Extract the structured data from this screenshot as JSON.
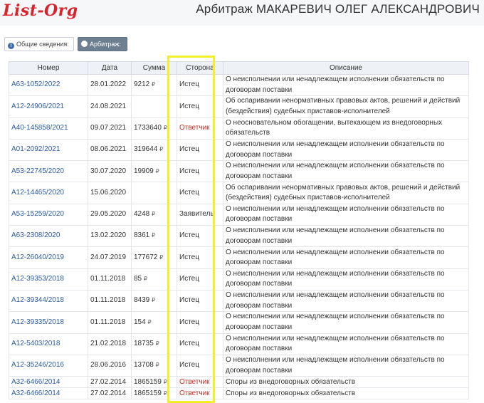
{
  "header": {
    "logo": "List-Org",
    "title": "Арбитраж МАКАРЕВИЧ ОЛЕГ АЛЕКСАНДРОВИЧ"
  },
  "tabs": [
    {
      "label": "Общие сведения:",
      "icon": "info-icon",
      "active": false
    },
    {
      "label": "Арбитраж:",
      "icon": "circle-icon",
      "active": true
    }
  ],
  "table": {
    "columns": [
      "Номер",
      "Дата",
      "Сумма",
      "Сторона",
      "Описание"
    ],
    "currency": "₽",
    "rows": [
      {
        "number": "А63-1052/2022",
        "date": "28.01.2022",
        "sum": "9212",
        "side": "Истец",
        "role": "plaintiff",
        "desc": "О неисполнении или ненадлежащем исполнении обязательств по договорам поставки"
      },
      {
        "number": "А12-24906/2021",
        "date": "24.08.2021",
        "sum": "",
        "side": "Истец",
        "role": "plaintiff",
        "desc": "Об оспаривании ненормативных правовых актов, решений и действий (бездействия) судебных приставов-исполнителей"
      },
      {
        "number": "А40-145858/2021",
        "date": "09.07.2021",
        "sum": "1733640",
        "side": "Ответчик",
        "role": "defendant",
        "desc": "О неосновательном обогащении, вытекающем из внедоговорных обязательств"
      },
      {
        "number": "А01-2092/2021",
        "date": "08.06.2021",
        "sum": "319644",
        "side": "Истец",
        "role": "plaintiff",
        "desc": "О неисполнении или ненадлежащем исполнении обязательств по договорам поставки"
      },
      {
        "number": "А53-22745/2020",
        "date": "30.07.2020",
        "sum": "19909",
        "side": "Истец",
        "role": "plaintiff",
        "desc": "О неисполнении или ненадлежащем исполнении обязательств по договорам поставки"
      },
      {
        "number": "А12-14465/2020",
        "date": "15.06.2020",
        "sum": "",
        "side": "Истец",
        "role": "plaintiff",
        "desc": "Об оспаривании ненормативных правовых актов, решений и действий (бездействия) судебных приставов-исполнителей"
      },
      {
        "number": "А53-15259/2020",
        "date": "29.05.2020",
        "sum": "4248",
        "side": "Заявитель",
        "role": "plaintiff",
        "desc": "О неисполнении или ненадлежащем исполнении обязательств по договорам поставки"
      },
      {
        "number": "А63-2308/2020",
        "date": "13.02.2020",
        "sum": "8361",
        "side": "Истец",
        "role": "plaintiff",
        "desc": "О неисполнении или ненадлежащем исполнении обязательств по договорам поставки"
      },
      {
        "number": "А12-26040/2019",
        "date": "24.07.2019",
        "sum": "177672",
        "side": "Истец",
        "role": "plaintiff",
        "desc": "О неисполнении или ненадлежащем исполнении обязательств по договорам поставки"
      },
      {
        "number": "А12-39353/2018",
        "date": "01.11.2018",
        "sum": "85",
        "side": "Истец",
        "role": "plaintiff",
        "desc": "О неисполнении или ненадлежащем исполнении обязательств по договорам поставки"
      },
      {
        "number": "А12-39344/2018",
        "date": "01.11.2018",
        "sum": "8439",
        "side": "Истец",
        "role": "plaintiff",
        "desc": "О неисполнении или ненадлежащем исполнении обязательств по договорам поставки"
      },
      {
        "number": "А12-39335/2018",
        "date": "01.11.2018",
        "sum": "154",
        "side": "Истец",
        "role": "plaintiff",
        "desc": "О неисполнении или ненадлежащем исполнении обязательств по договорам поставки"
      },
      {
        "number": "А12-5403/2018",
        "date": "21.02.2018",
        "sum": "18735",
        "side": "Истец",
        "role": "plaintiff",
        "desc": "О неисполнении или ненадлежащем исполнении обязательств по договорам поставки"
      },
      {
        "number": "А12-35246/2016",
        "date": "28.06.2016",
        "sum": "13708",
        "side": "Истец",
        "role": "plaintiff",
        "desc": "О неисполнении или ненадлежащем исполнении обязательств по договорам поставки"
      },
      {
        "number": "А32-6466/2014",
        "date": "27.02.2014",
        "sum": "1865159",
        "side": "Ответчик",
        "role": "defendant",
        "desc": "Споры из внедоговорных обязательств"
      },
      {
        "number": "А32-6466/2014",
        "date": "27.02.2014",
        "sum": "1865159",
        "side": "Ответчик",
        "role": "defendant",
        "desc": "Споры из внедоговорных обязательств"
      }
    ]
  },
  "colors": {
    "logo": "#d9232d",
    "link": "#2a5ca8",
    "defendant": "#cc2a1e",
    "highlight": "#f5ef2a",
    "active_tab": "#6f7f92"
  }
}
